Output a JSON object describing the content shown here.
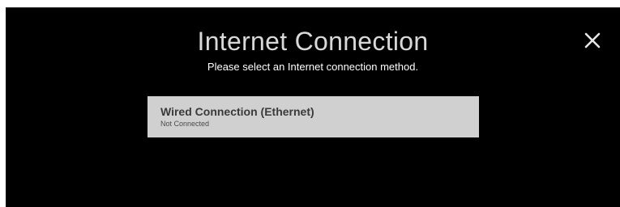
{
  "dialog": {
    "title": "Internet Connection",
    "subtitle": "Please select an Internet connection method.",
    "close_icon": "close-icon"
  },
  "options": [
    {
      "label": "Wired Connection (Ethernet)",
      "status": "Not Connected"
    }
  ],
  "colors": {
    "background": "#000000",
    "option_background": "#d0d0d0",
    "title_text": "#d8d8d8"
  }
}
